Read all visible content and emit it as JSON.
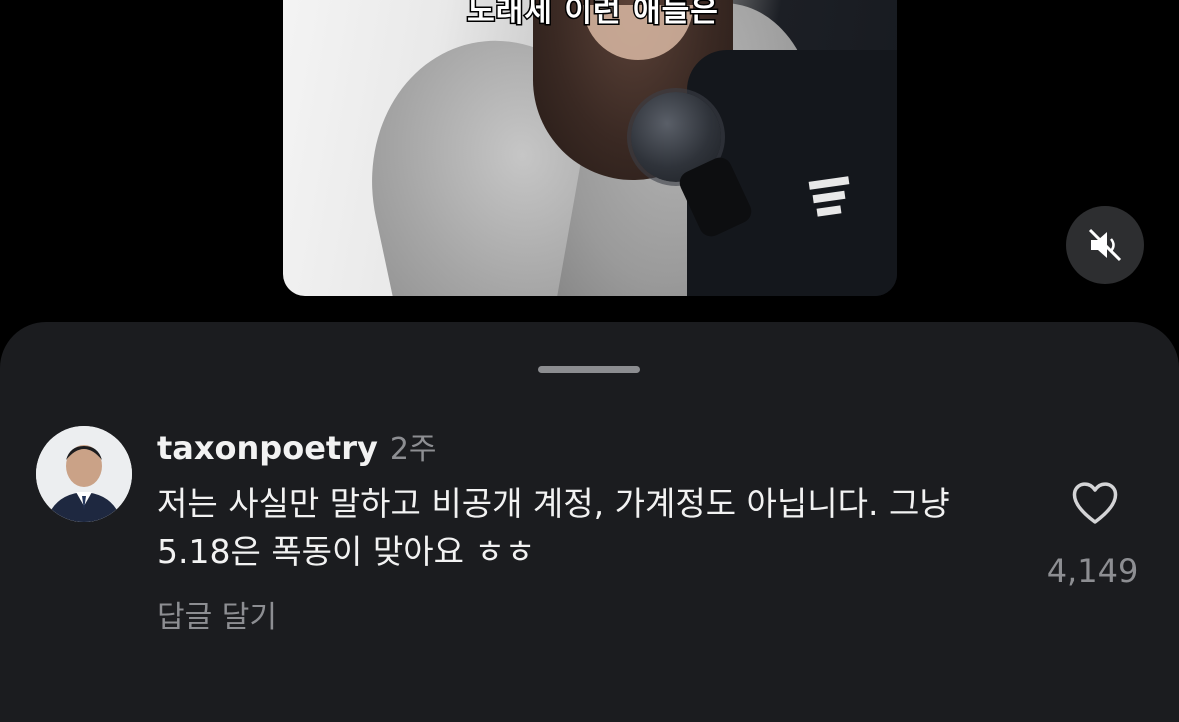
{
  "video": {
    "caption_overlay": "노래세 이런 애들은",
    "mute_icon": "speaker-muted-icon"
  },
  "comment": {
    "username": "taxonpoetry",
    "time": "2주",
    "text": "저는 사실만 말하고 비공개 계정, 가계정도 아닙니다. 그냥 5.18은 폭동이 맞아요 ㅎㅎ",
    "reply_label": "답글 달기",
    "like_count": "4,149",
    "like_icon": "heart-outline-icon"
  },
  "sheet": {
    "handle": "drag-handle"
  }
}
